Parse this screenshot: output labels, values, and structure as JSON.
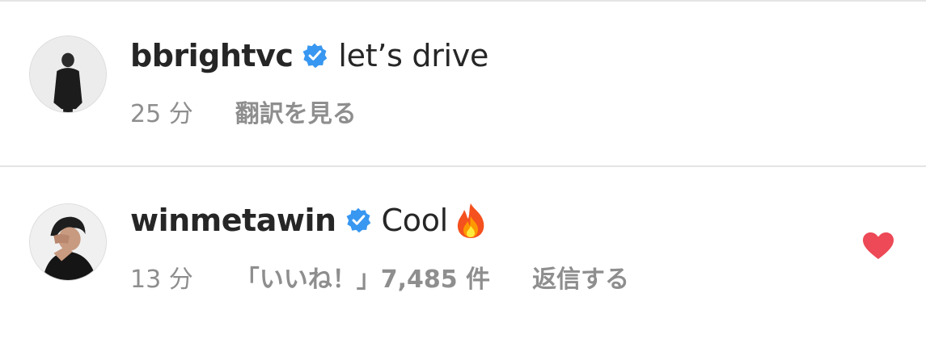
{
  "comments": [
    {
      "username": "bbrightvc",
      "verified": true,
      "text": "let’s drive",
      "timestamp": "25 分",
      "translate_label": "翻訳を見る"
    },
    {
      "username": "winmetawin",
      "verified": true,
      "text": "Cool",
      "emoji_icon": "fire-icon",
      "timestamp": "13 分",
      "likes_label": "「いいね！」7,485 件",
      "reply_label": "返信する",
      "liked": true
    }
  ],
  "colors": {
    "verified_badge": "#3897f0",
    "like_heart": "#ed4956",
    "meta_text": "#8e8e8e",
    "primary_text": "#262626"
  }
}
